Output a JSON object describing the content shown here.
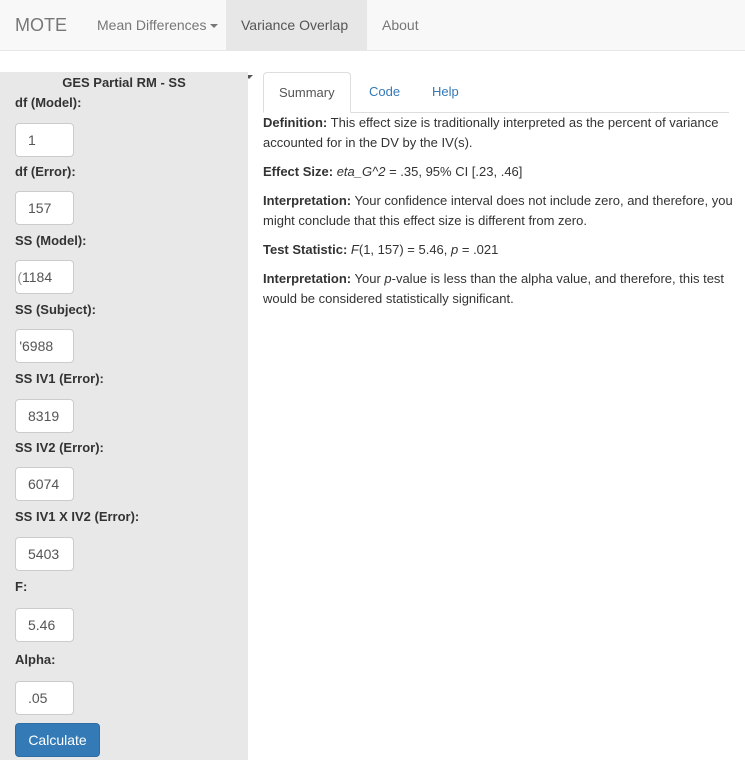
{
  "navbar": {
    "brand": "MOTE",
    "items": [
      {
        "label": "Mean Differences",
        "dropdown": true
      },
      {
        "label": "Variance Overlap",
        "dropdown": true,
        "active": true
      },
      {
        "label": "About",
        "dropdown": false
      }
    ]
  },
  "sidebar": {
    "title": "GES Partial RM - SS",
    "fields": [
      {
        "label": "df (Model):",
        "value": "1"
      },
      {
        "label": "df (Error):",
        "value": "157"
      },
      {
        "label": "SS (Model):",
        "value": "1184",
        "clipped": true
      },
      {
        "label": "SS (Subject):",
        "value": "6988",
        "clipped": true
      },
      {
        "label": "SS IV1 (Error):",
        "value": "8319"
      },
      {
        "label": "SS IV2 (Error):",
        "value": "6074"
      },
      {
        "label": "SS IV1 X IV2 (Error):",
        "value": "5403"
      },
      {
        "label": "F:",
        "value": "5.46"
      },
      {
        "label": "Alpha:",
        "value": ".05"
      }
    ],
    "button": "Calculate"
  },
  "tabs": [
    "Summary",
    "Code",
    "Help"
  ],
  "summary": {
    "definition_label": "Definition:",
    "definition": " This effect size is traditionally interpreted as the percent of variance accounted for in the DV by the IV(s).",
    "effect_label": "Effect Size:",
    "effect_symbol": "eta_G^2",
    "effect_value": " = .35, 95% CI [.23, .46]",
    "interp1_label": "Interpretation:",
    "interp1": " Your confidence interval does not include zero, and therefore, you might conclude that this effect size is different from zero.",
    "test_label": "Test Statistic:",
    "test_f": "F",
    "test_mid": "(1, 157) = 5.46, ",
    "test_p": "p",
    "test_end": " = .021",
    "interp2_label": "Interpretation:",
    "interp2_pre": " Your ",
    "interp2_p": "p",
    "interp2_post": "-value is less than the alpha value, and therefore, this test would be considered statistically significant."
  },
  "colors": {
    "primary": "#337ab7",
    "sidebar_bg": "#e8e8e8",
    "navbar_bg": "#f8f8f8"
  }
}
